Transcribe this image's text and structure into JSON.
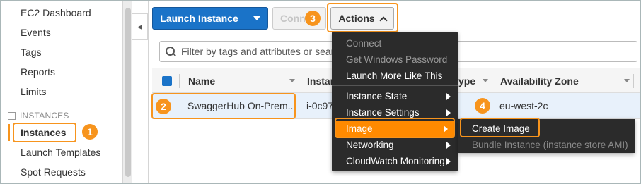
{
  "sidebar": {
    "items": [
      "EC2 Dashboard",
      "Events",
      "Tags",
      "Reports",
      "Limits"
    ],
    "section_title": "INSTANCES",
    "section_items": [
      "Instances",
      "Launch Templates",
      "Spot Requests"
    ],
    "active_item": "Instances"
  },
  "toolbar": {
    "launch_label": "Launch Instance",
    "connect_label": "Conn",
    "actions_label": "Actions"
  },
  "search": {
    "placeholder": "Filter by tags and attributes or search by keyword"
  },
  "table": {
    "columns": [
      "Name",
      "Instan",
      "ype",
      "Availability Zone"
    ],
    "row": {
      "name": "SwaggerHub On-Prem...",
      "instance_id": "i-0c97",
      "availability_zone": "eu-west-2c"
    }
  },
  "menu": {
    "items": [
      {
        "label": "Connect",
        "disabled": true
      },
      {
        "label": "Get Windows Password",
        "disabled": true
      },
      {
        "label": "Launch More Like This",
        "disabled": false
      },
      {
        "label": "Instance State",
        "submenu": true
      },
      {
        "label": "Instance Settings",
        "submenu": true
      },
      {
        "label": "Image",
        "submenu": true,
        "active": true
      },
      {
        "label": "Networking",
        "submenu": true
      },
      {
        "label": "CloudWatch Monitoring",
        "submenu": true
      }
    ],
    "image_submenu": [
      {
        "label": "Create Image",
        "disabled": false
      },
      {
        "label": "Bundle Instance (instance store AMI)",
        "disabled": true
      }
    ]
  },
  "steps": [
    "1",
    "2",
    "3",
    "4"
  ],
  "colors": {
    "primary": "#1a73c8",
    "highlight": "#f7941d",
    "menu_bg": "#2b2b2b",
    "menu_active": "#ff8a00"
  }
}
